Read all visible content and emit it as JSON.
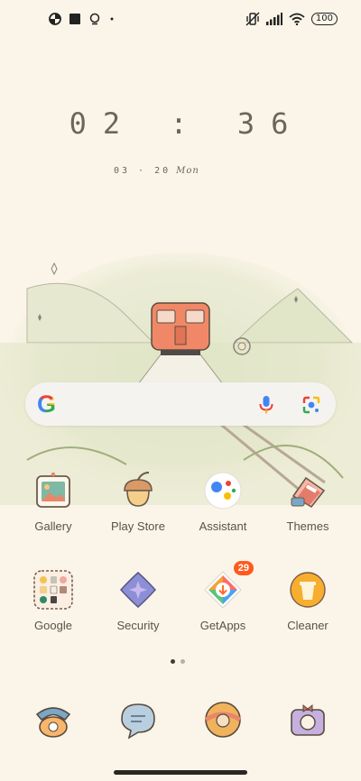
{
  "status_bar": {
    "left_icons": [
      "pie-icon",
      "square-app-icon",
      "bulb-icon",
      "dot-icon"
    ],
    "right_icons": [
      "vibrate-mute-icon",
      "signal-icon",
      "wifi-icon"
    ],
    "battery": "100"
  },
  "clock": {
    "time": "02 : 36",
    "date": "03 · 20",
    "weekday": "Mon"
  },
  "search": {
    "logo": "G",
    "mic_icon": "mic-icon",
    "lens_icon": "lens-icon"
  },
  "apps_row1": [
    {
      "label": "Gallery",
      "icon": "gallery-icon"
    },
    {
      "label": "Play Store",
      "icon": "acorn-icon"
    },
    {
      "label": "Assistant",
      "icon": "assistant-icon"
    },
    {
      "label": "Themes",
      "icon": "themes-icon"
    }
  ],
  "apps_row2": [
    {
      "label": "Google",
      "icon": "folder-icon"
    },
    {
      "label": "Security",
      "icon": "security-icon"
    },
    {
      "label": "GetApps",
      "icon": "getapps-icon",
      "badge": "29"
    },
    {
      "label": "Cleaner",
      "icon": "cleaner-icon"
    }
  ],
  "page_dots": {
    "count": 2,
    "active": 0
  },
  "dock": [
    "phone-icon",
    "messages-icon",
    "browser-icon",
    "camera-icon"
  ],
  "colors": {
    "background": "#fbf5e9",
    "badge": "#ff5a1e",
    "google_blue": "#4285f4",
    "google_red": "#ea4335",
    "google_yellow": "#fbbc05",
    "google_green": "#34a853"
  }
}
